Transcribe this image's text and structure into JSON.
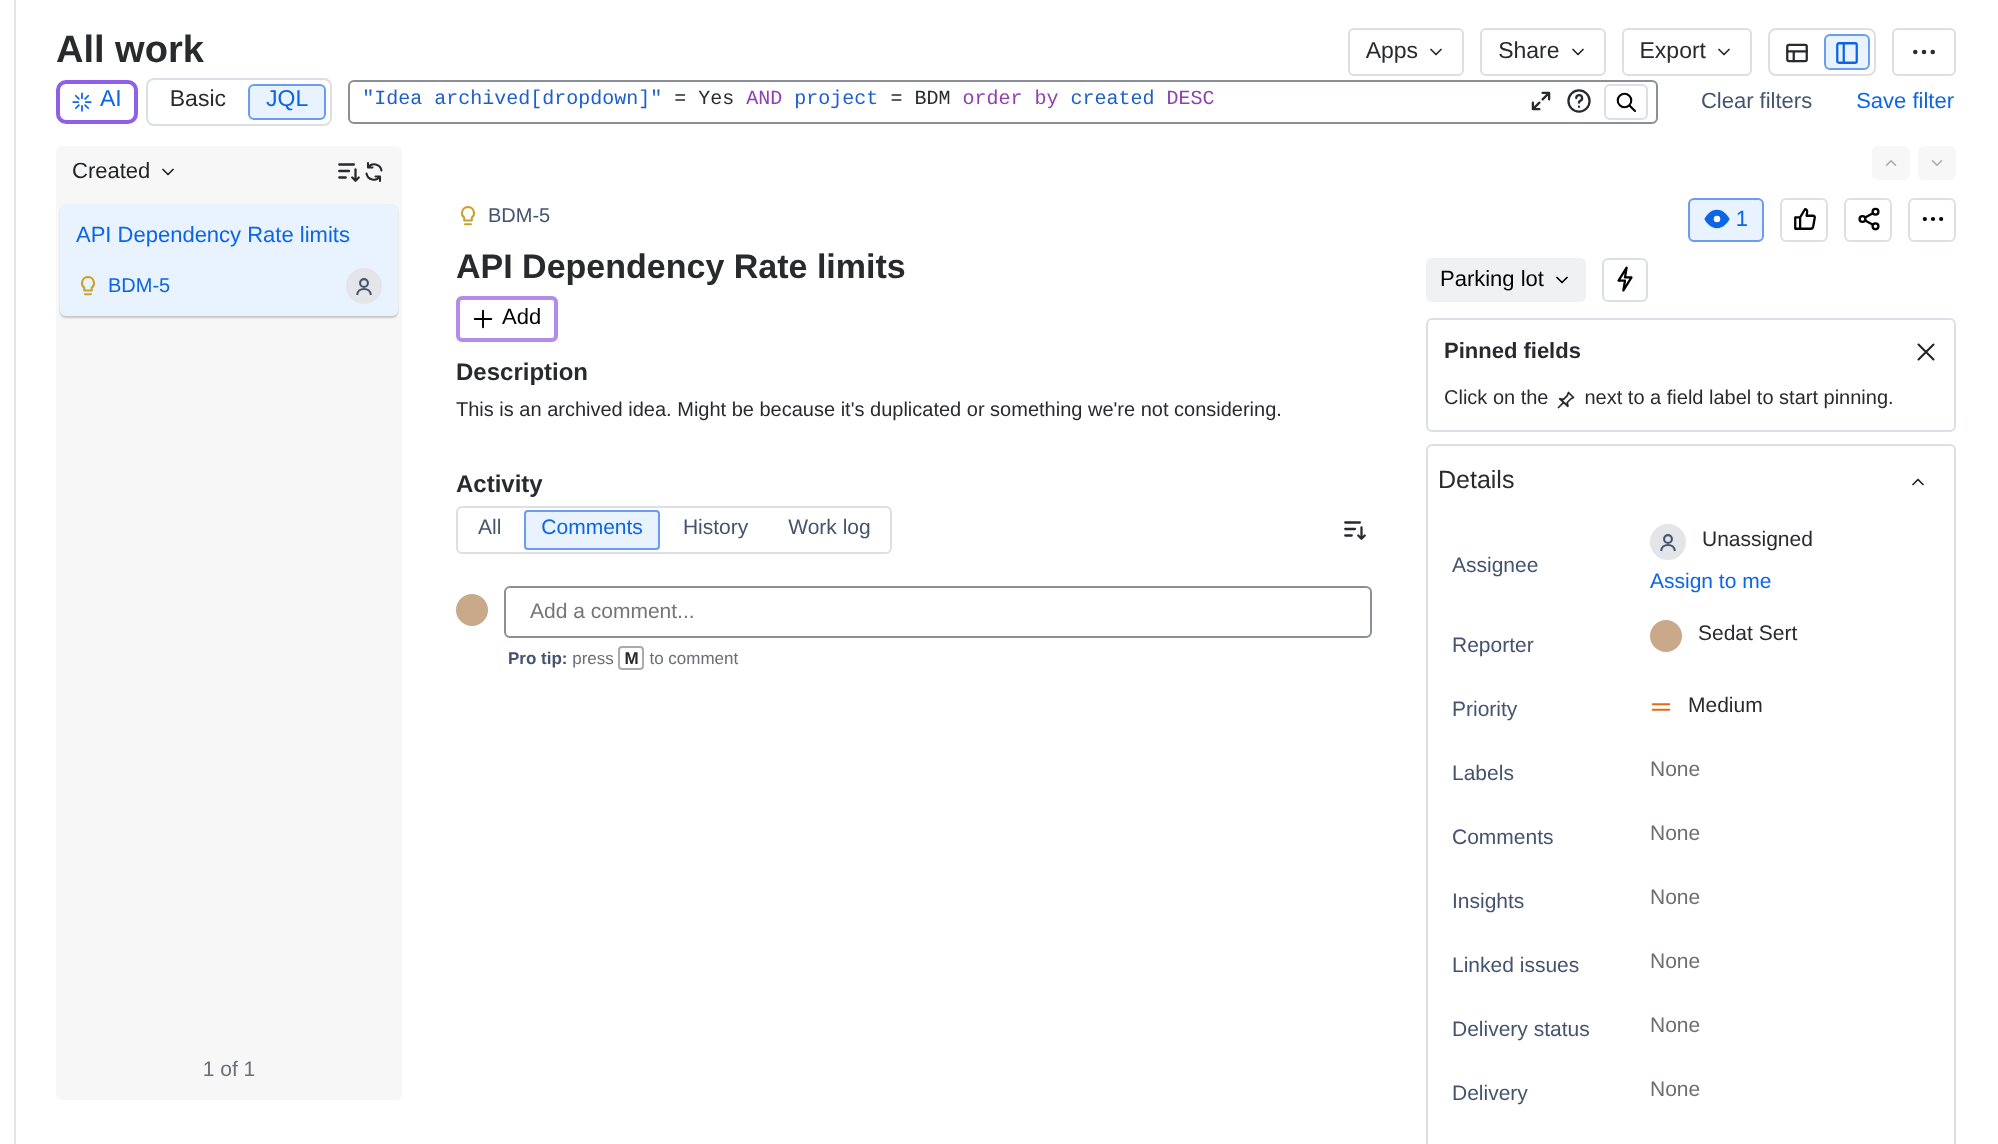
{
  "page_title": "All work",
  "header_buttons": [
    {
      "label": "Apps",
      "kind": "dropdown"
    },
    {
      "label": "Share",
      "kind": "dropdown"
    },
    {
      "label": "Export",
      "kind": "dropdown"
    }
  ],
  "view_toggle": [
    {
      "kind": "list",
      "selected": false
    },
    {
      "kind": "detail",
      "selected": true
    }
  ],
  "ai_button": {
    "label": "AI"
  },
  "search_modes": [
    {
      "label": "Basic",
      "kind": "mode",
      "selected": false
    },
    {
      "label": "JQL",
      "kind": "mode",
      "selected": true
    }
  ],
  "jql_query": [
    {
      "text": "\"Idea archived[dropdown]\"",
      "kind": "field"
    },
    {
      "text": "=",
      "kind": "op"
    },
    {
      "text": "Yes",
      "kind": "value"
    },
    {
      "text": "AND",
      "kind": "keyword"
    },
    {
      "text": "project",
      "kind": "field"
    },
    {
      "text": "=",
      "kind": "op"
    },
    {
      "text": "BDM",
      "kind": "value"
    },
    {
      "text": "order by",
      "kind": "keyword"
    },
    {
      "text": "created",
      "kind": "field"
    },
    {
      "text": "DESC",
      "kind": "keyword"
    }
  ],
  "filter_actions": {
    "clear": "Clear filters",
    "save": "Save filter"
  },
  "list_panel": {
    "sort_label": "Created",
    "items": [
      {
        "title": "API Dependency Rate limits",
        "key": "BDM-5",
        "selected": true
      }
    ],
    "pagination": "1 of 1"
  },
  "issue": {
    "key": "BDM-5",
    "title": "API Dependency Rate limits",
    "add_label": "Add",
    "description_heading": "Description",
    "description": "This is an archived idea. Might be because it's duplicated or something we're not considering.",
    "activity_heading": "Activity",
    "activity_tabs": [
      {
        "label": "All",
        "selected": false
      },
      {
        "label": "Comments",
        "selected": true
      },
      {
        "label": "History",
        "selected": false
      },
      {
        "label": "Work log",
        "selected": false
      }
    ],
    "comment_placeholder": "Add a comment...",
    "pro_tip": {
      "lead": "Pro tip:",
      "before": "press",
      "key": "M",
      "after": "to comment"
    }
  },
  "side": {
    "watch_count": "1",
    "watching": true,
    "status": "Parking lot",
    "pinned": {
      "title": "Pinned fields",
      "before": "Click on the",
      "after": "next to a field label to start pinning."
    },
    "details_title": "Details",
    "expanded": true,
    "fields": [
      {
        "label": "Assignee",
        "kind": "assignee",
        "value": "Unassigned",
        "link": "Assign to me"
      },
      {
        "label": "Reporter",
        "kind": "person",
        "value": "Sedat Sert"
      },
      {
        "label": "Priority",
        "kind": "priority",
        "value": "Medium"
      },
      {
        "label": "Labels",
        "kind": "none",
        "value": "None"
      },
      {
        "label": "Comments",
        "kind": "none",
        "value": "None"
      },
      {
        "label": "Insights",
        "kind": "none",
        "value": "None"
      },
      {
        "label": "Linked issues",
        "kind": "none",
        "value": "None"
      },
      {
        "label": "Delivery status",
        "kind": "none",
        "value": "None"
      },
      {
        "label": "Delivery",
        "kind": "none",
        "value": "None"
      }
    ]
  }
}
